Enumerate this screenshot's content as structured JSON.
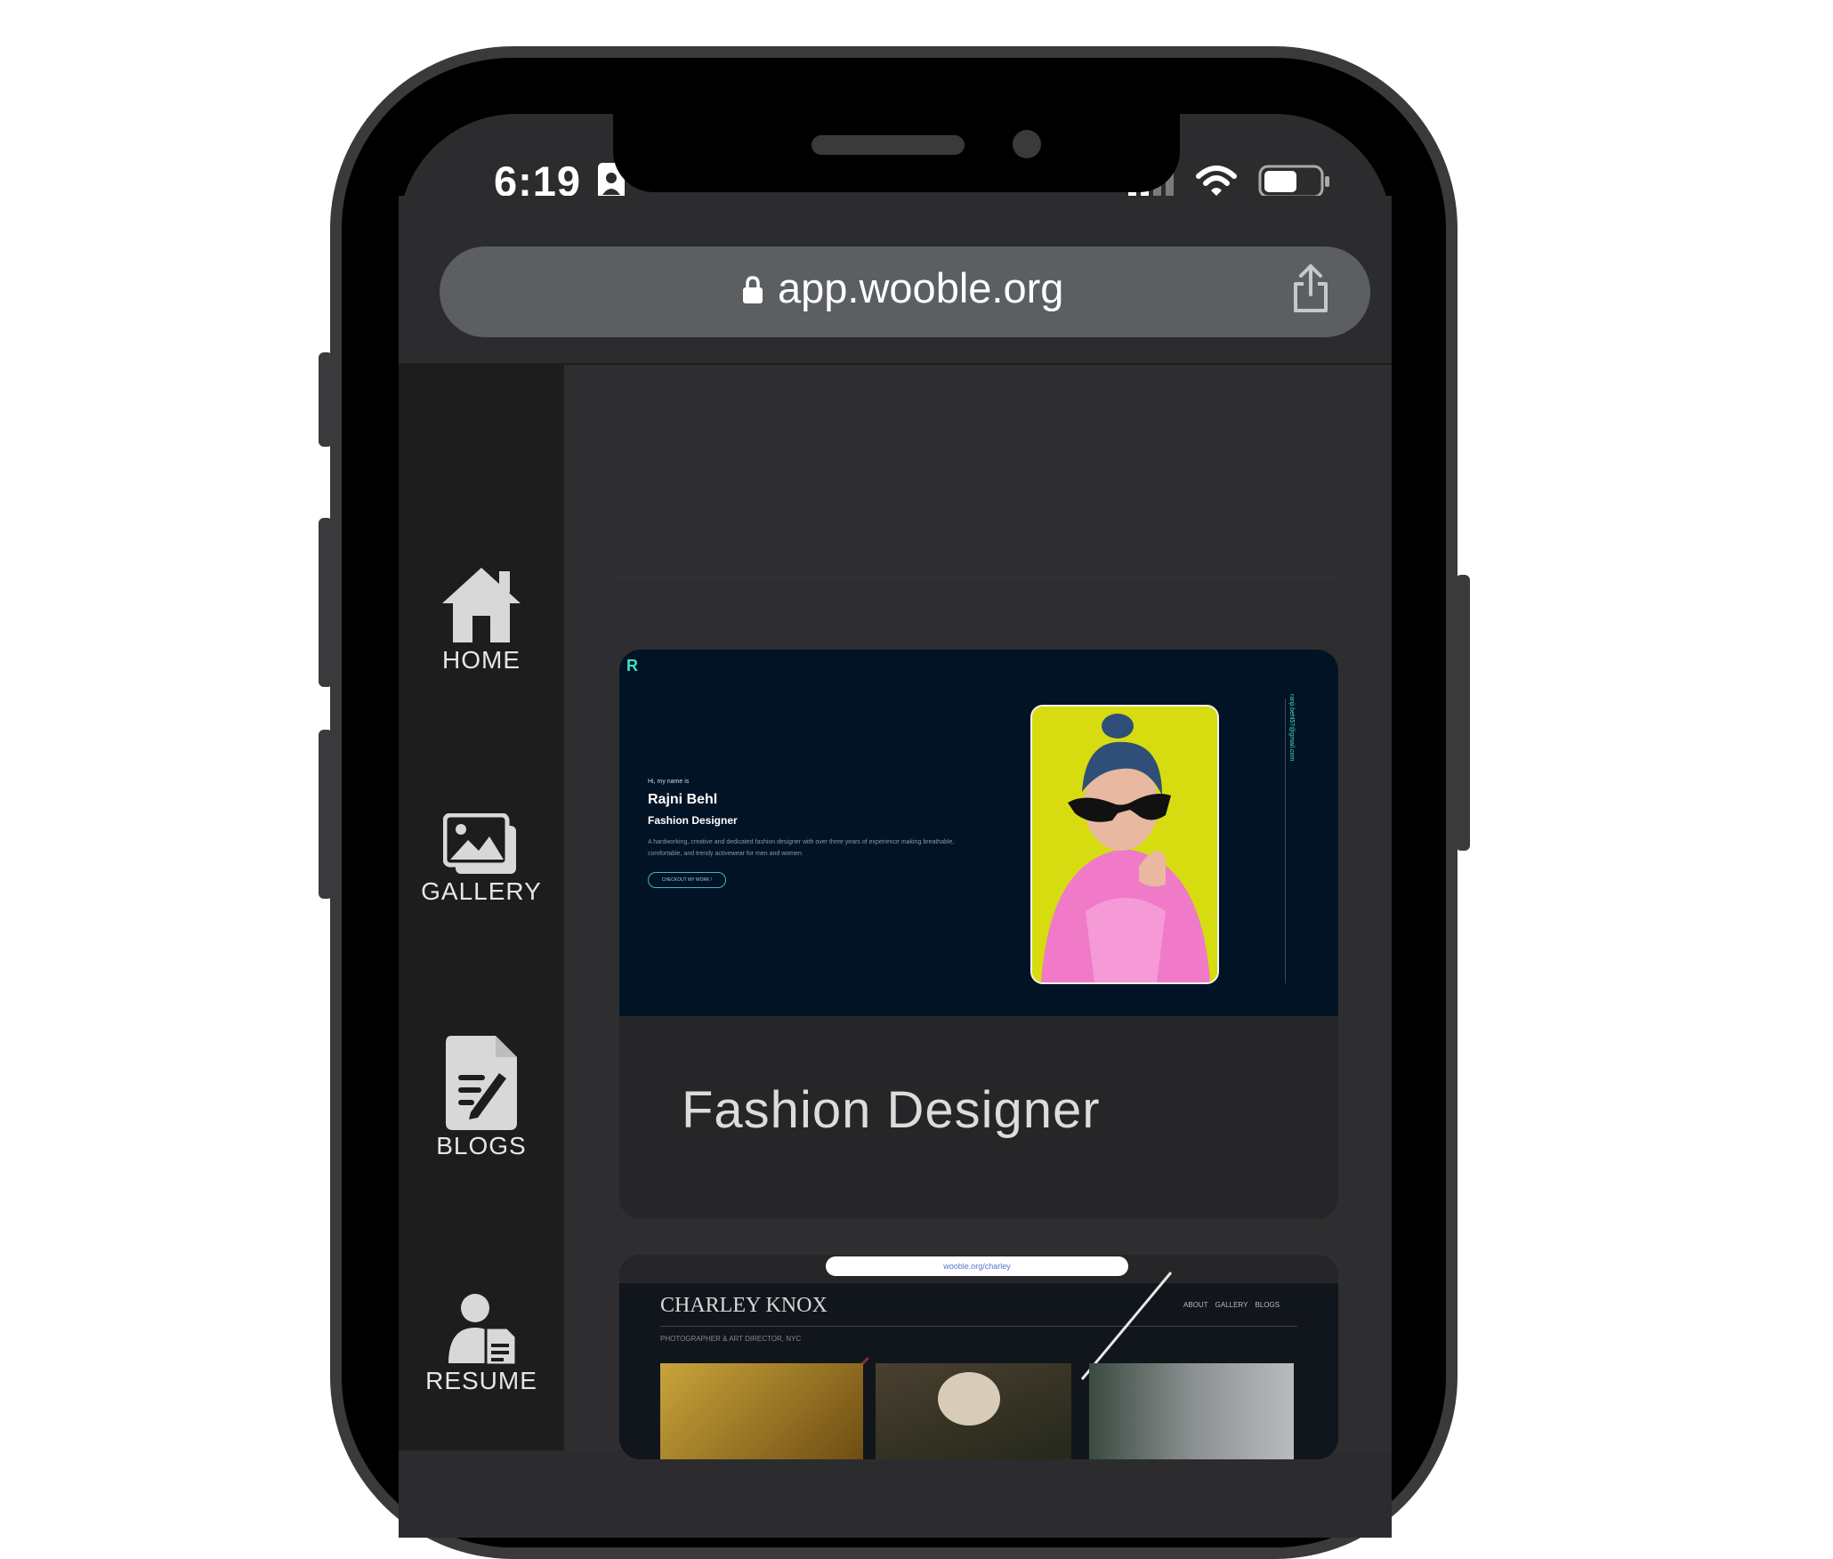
{
  "status_bar": {
    "time": "6:19"
  },
  "browser": {
    "url": "app.wooble.org"
  },
  "sidebar": {
    "items": [
      {
        "label": "HOME"
      },
      {
        "label": "GALLERY"
      },
      {
        "label": "BLOGS"
      },
      {
        "label": "RESUME"
      }
    ]
  },
  "cards": [
    {
      "title": "Fashion Designer",
      "preview": {
        "logo": "R",
        "greeting": "Hi, my name is",
        "name": "Rajni Behl",
        "role": "Fashion Designer",
        "description": "A hardworking, creative and dedicated fashion designer with over three years of experience making breathable, comfortable, and trendy activewear for men and women.",
        "cta": "CHECKOUT MY WORK !",
        "email": "ranji.behl57@gmail.com"
      }
    },
    {
      "preview": {
        "url": "wooble.org/charley",
        "name": "CHARLEY KNOX",
        "subtitle": "PHOTOGRAPHER & ART DIRECTOR, NYC",
        "nav": "ABOUT GALLERY BLOGS"
      }
    }
  ],
  "colors": {
    "screen_bg": "#2c2c2e",
    "sidebar_bg": "#1d1d1e",
    "accent": "#3fe0c5"
  }
}
